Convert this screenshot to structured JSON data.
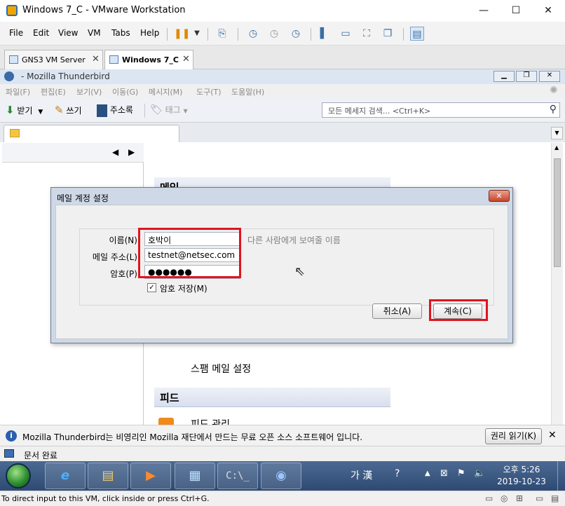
{
  "vmware": {
    "title": "Windows 7_C - VMware Workstation",
    "window_controls": {
      "minimize": "—",
      "maximize": "☐",
      "close": "✕"
    },
    "menu": [
      "File",
      "Edit",
      "View",
      "VM",
      "Tabs",
      "Help"
    ],
    "tabs": [
      {
        "label": "GNS3 VM Server",
        "close": "✕"
      },
      {
        "label": "Windows 7_C",
        "close": "✕"
      }
    ],
    "bottom_hint": "To direct input to this VM, click inside or press Ctrl+G."
  },
  "thunderbird": {
    "title": "- Mozilla Thunderbird",
    "menu": [
      "파일(F)",
      "편집(E)",
      "보기(V)",
      "이동(G)",
      "메시지(M)",
      "도구(T)",
      "도움말(H)"
    ],
    "toolbar": {
      "receive": "받기",
      "write": "쓰기",
      "address_book": "주소록",
      "tag": "태그"
    },
    "search_placeholder": "모든 메세지 검색... <Ctrl+K>",
    "sections": {
      "mail": "메일",
      "spam_settings": "스팸 메일 설정",
      "feed": "피드",
      "feed_item": "피드 관리"
    },
    "notification": {
      "text": "Mozilla Thunderbird는 비영리인 Mozilla 재단에서 만드는 무료 오픈 소스 소프트웨어 입니다.",
      "button": "권리 읽기(K)",
      "close": "✕"
    },
    "status": "문서 완료"
  },
  "dialog": {
    "title": "메일 계정 설정",
    "close": "✕",
    "name_label": "이름(N):",
    "name_value": "호박이",
    "name_hint": "다른 사람에게 보여줄 이름",
    "email_label": "메일 주소(L):",
    "email_value": "testnet@netsec.com",
    "password_label": "암호(P):",
    "password_value": "●●●●●●",
    "remember_label": "암호 저장(M)",
    "remember_checked": "✓",
    "cancel_button": "취소(A)",
    "continue_button": "계속(C)"
  },
  "taskbar": {
    "ime": "가 漢",
    "clock_time": "오후 5:26",
    "clock_date": "2019-10-23"
  },
  "colors": {
    "highlight": "#e0141e",
    "taskbar": "#2e4a73"
  }
}
